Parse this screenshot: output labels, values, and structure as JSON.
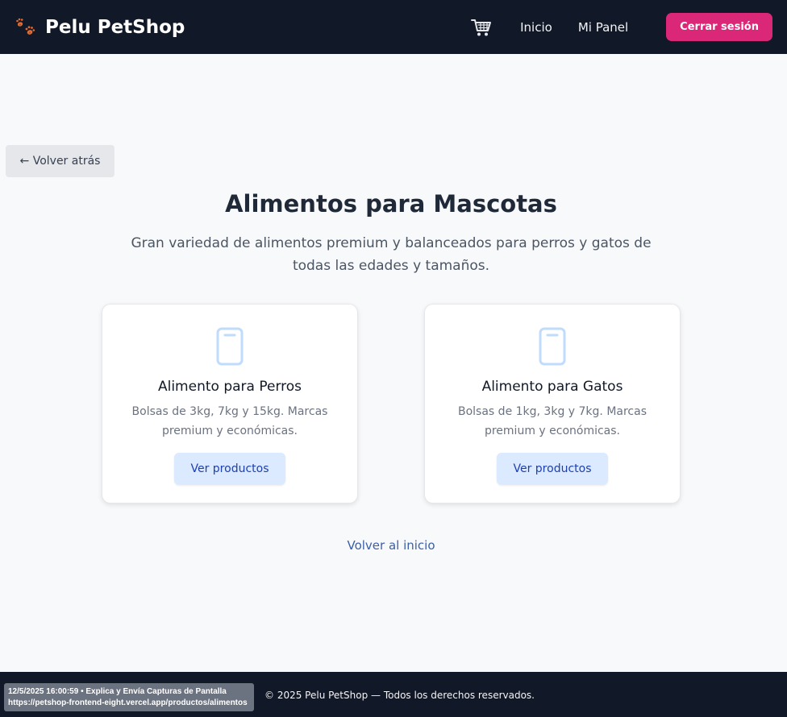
{
  "header": {
    "brand_name": "Pelu PetShop",
    "brand_icon": "paw-prints-icon",
    "cart_icon": "shopping-cart-icon",
    "nav_links": [
      "Inicio",
      "Mi Panel"
    ],
    "logout_label": "Cerrar sesión"
  },
  "back_button": {
    "label": "← Volver atrás"
  },
  "main": {
    "title": "Alimentos para Mascotas",
    "subtitle": "Gran variedad de alimentos premium y balanceados para perros y gatos de todas las edades y tamaños.",
    "cards": [
      {
        "icon": "food-bag-icon",
        "title": "Alimento para Perros",
        "description": "Bolsas de 3kg, 7kg y 15kg. Marcas premium y económicas.",
        "button_label": "Ver productos"
      },
      {
        "icon": "food-bag-icon",
        "title": "Alimento para Gatos",
        "description": "Bolsas de 1kg, 3kg y 7kg. Marcas premium y económicas.",
        "button_label": "Ver productos"
      }
    ],
    "home_link": "Volver al inicio"
  },
  "footer": {
    "text": "© 2025 Pelu PetShop — Todos los derechos reservados."
  },
  "capture_overlay": {
    "line1": "12/5/2025 16:00:59 • Explica y Envía Capturas de Pantalla",
    "line2": "https://petshop-frontend-eight.vercel.app/productos/alimentos"
  },
  "colors": {
    "navbar_bg": "#111827",
    "accent_pink": "#db2777",
    "card_button_bg": "#dbeafe",
    "card_button_text": "#1e40af",
    "icon_blue": "#bfdbfe"
  }
}
